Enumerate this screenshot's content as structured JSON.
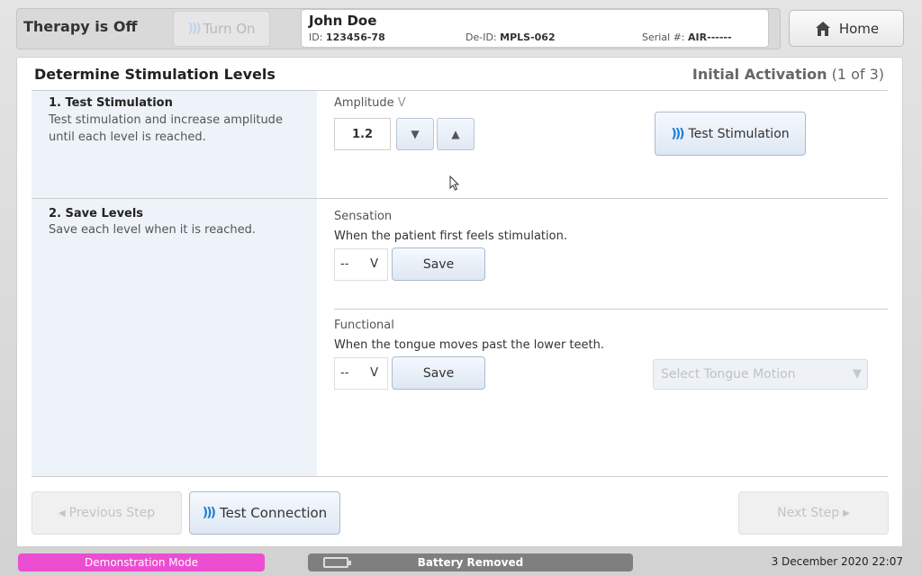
{
  "topbar": {
    "therapy_status": "Therapy is Off",
    "turn_on_label": "Turn On",
    "home_label": "Home"
  },
  "patient": {
    "name": "John Doe",
    "id_label": "ID:",
    "id_value": "123456-78",
    "deid_label": "De-ID:",
    "deid_value": "MPLS-062",
    "serial_label": "Serial #:",
    "serial_value": "AIR------"
  },
  "panel": {
    "title": "Determine Stimulation Levels",
    "step_title": "Initial Activation",
    "step_counter": "(1 of 3)"
  },
  "section1": {
    "title": "1. Test Stimulation",
    "description": "Test stimulation and increase amplitude until each level is reached.",
    "amplitude_label": "Amplitude",
    "amplitude_unit": "V",
    "amplitude_value": "1.2",
    "test_button": "Test Stimulation"
  },
  "section2": {
    "title": "2. Save Levels",
    "description": "Save each level when it is reached.",
    "sensation": {
      "label": "Sensation",
      "description": "When the patient first feels stimulation.",
      "value": "--",
      "unit": "V",
      "save_label": "Save"
    },
    "functional": {
      "label": "Functional",
      "description": "When the tongue moves past the lower teeth.",
      "value": "--",
      "unit": "V",
      "save_label": "Save",
      "select_placeholder": "Select Tongue Motion"
    }
  },
  "footer": {
    "previous_step": "Previous Step",
    "test_connection": "Test Connection",
    "next_step": "Next Step"
  },
  "statusbar": {
    "demo_mode": "Demonstration Mode",
    "battery": "Battery Removed",
    "datetime": "3 December 2020 22:07"
  },
  "colors": {
    "demo_pink": "#ec4dd1",
    "signal_blue": "#1f7fd6",
    "left_column_bg": "#eef3fa"
  }
}
